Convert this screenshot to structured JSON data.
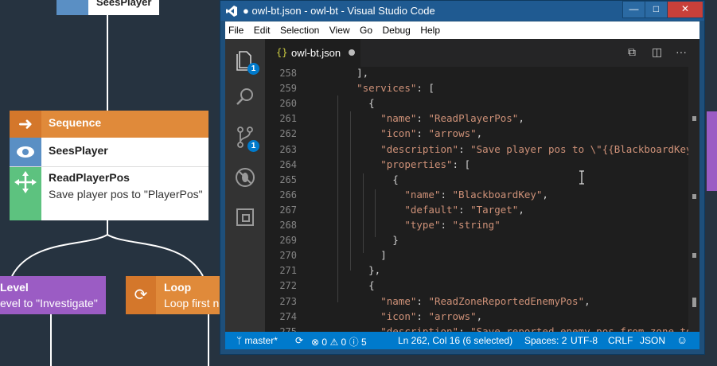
{
  "background_tree": {
    "top_node_label": "SeesPlayer",
    "sequence": {
      "title": "Sequence",
      "child1": "SeesPlayer",
      "child2_title": "ReadPlayerPos",
      "child2_desc": "Save player pos to \"PlayerPos\""
    },
    "level_node": {
      "title": "Level",
      "desc": "evel to \"Investigate\""
    },
    "loop_node": {
      "title": "Loop",
      "desc": "Loop first n"
    }
  },
  "window": {
    "title": "● owl-bt.json - owl-bt - Visual Studio Code",
    "min_label": "—",
    "max_label": "□",
    "close_label": "✕"
  },
  "menu": [
    "File",
    "Edit",
    "Selection",
    "View",
    "Go",
    "Debug",
    "Help"
  ],
  "activity_bar": {
    "explorer_badge": "1",
    "scm_badge": "1"
  },
  "tab": {
    "icon": "{}",
    "filename": "owl-bt.json"
  },
  "editor": {
    "line_numbers": [
      "258",
      "259",
      "260",
      "261",
      "262",
      "263",
      "264",
      "265",
      "266",
      "267",
      "268",
      "269",
      "270",
      "271",
      "272",
      "273",
      "274",
      "275"
    ],
    "lines": [
      "    ],",
      "    \"services\": [",
      "      {",
      "        \"name\": \"ReadPlayerPos\",",
      "        \"icon\": \"arrows\",",
      "        \"description\": \"Save player pos to \\\"{{BlackboardKey}}\\\"",
      "        \"properties\": [",
      "          {",
      "            \"name\": \"BlackboardKey\",",
      "            \"default\": \"Target\",",
      "            \"type\": \"string\"",
      "          }",
      "        ]",
      "      },",
      "      {",
      "        \"name\": \"ReadZoneReportedEnemyPos\",",
      "        \"icon\": \"arrows\",",
      "        \"description\": \"Save reported enemy pos from zone to \\\"{"
    ]
  },
  "status": {
    "branch": "master*",
    "errors": "0",
    "warnings": "0",
    "info": "5",
    "position": "Ln 262, Col 16 (6 selected)",
    "spaces": "Spaces: 2",
    "encoding": "UTF-8",
    "eol": "CRLF",
    "language": "JSON"
  },
  "colors": {
    "status_bar": "#007acc",
    "title_bar": "#1f5a91",
    "string": "#ce9178",
    "key_orange": "#e08a3a",
    "node_purple": "#9b5cc4",
    "node_green": "#5dc27f",
    "node_blue": "#5a8fc4"
  }
}
